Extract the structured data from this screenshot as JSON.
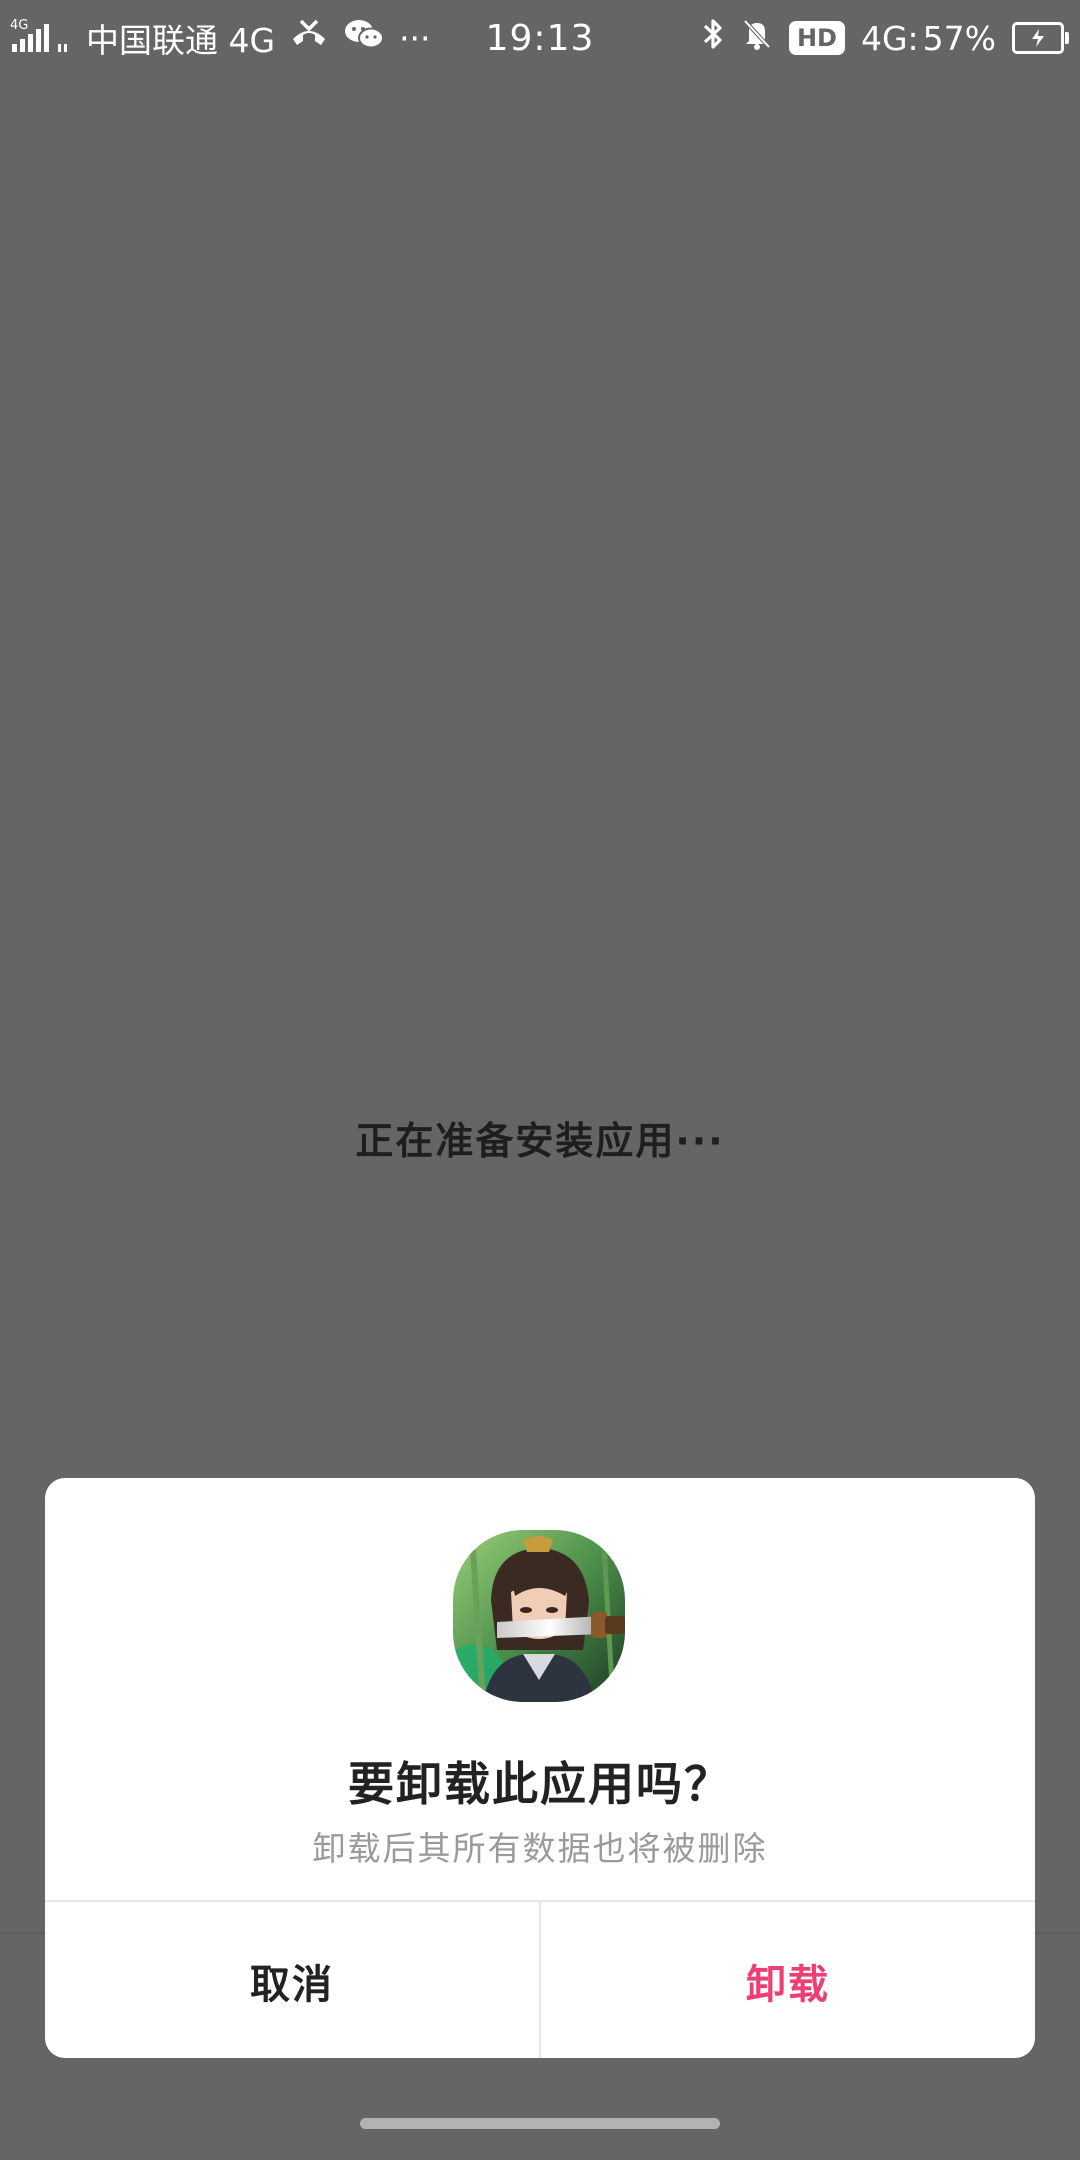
{
  "status_bar": {
    "network_small": "4G",
    "carrier": "中国联通 4G",
    "more": "···",
    "time": "19:13",
    "hd_badge": "HD",
    "network": "4G:",
    "battery_percent": "57%",
    "battery_level": 0.57,
    "icons": [
      "signal-icon",
      "phone-call-icon",
      "wechat-icon",
      "bluetooth-icon",
      "mute-bell-icon",
      "battery-charging-icon"
    ]
  },
  "main": {
    "status_text": "正在准备安装应用···"
  },
  "dialog": {
    "title": "要卸载此应用吗？",
    "message": "卸载后其所有数据也将被删除",
    "cancel_label": "取消",
    "confirm_label": "卸载",
    "confirm_color": "#ee3f74",
    "app_icon": "game-character-app-icon"
  },
  "colors": {
    "background_dim": "#656565",
    "dialog_bg": "#ffffff"
  }
}
